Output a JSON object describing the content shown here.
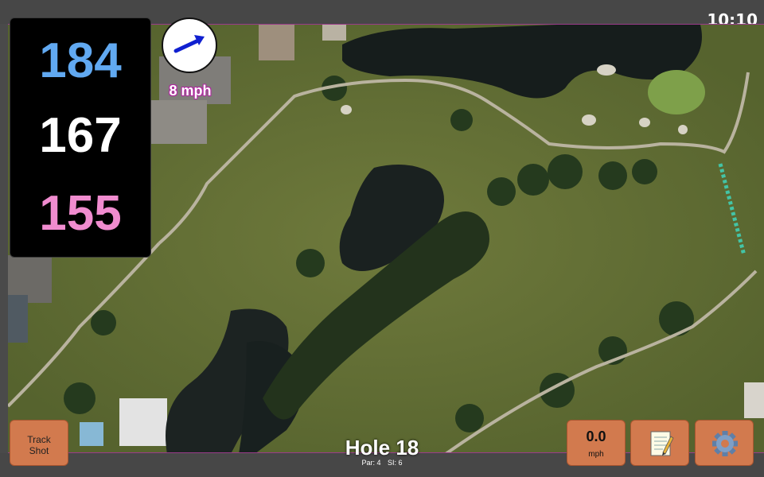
{
  "status_bar": {
    "time": "10:10"
  },
  "distances": {
    "back": "184",
    "middle": "167",
    "front": "155"
  },
  "wind": {
    "speed": "8 mph",
    "icon": "arrow-icon"
  },
  "hole": {
    "title": "Hole 18",
    "par": "Par: 4",
    "si": "SI: 6"
  },
  "buttons": {
    "track_shot_line1": "Track",
    "track_shot_line2": "Shot",
    "speed_value": "0.0",
    "speed_unit": "mph",
    "notes_icon": "notepad-icon",
    "settings_icon": "gear-icon"
  },
  "colors": {
    "back_distance": "#61a9f1",
    "middle_distance": "#ffffff",
    "front_distance": "#f08ccf",
    "button": "#d27a4e",
    "map_border": "#9a3b8a"
  }
}
